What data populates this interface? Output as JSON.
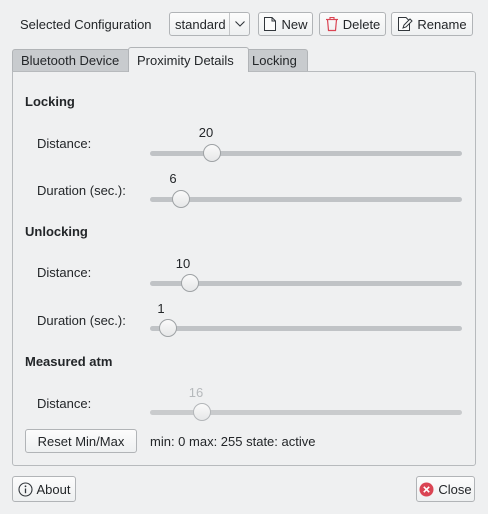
{
  "config": {
    "label": "Selected Configuration",
    "selected": "standard",
    "new_label": "New",
    "delete_label": "Delete",
    "rename_label": "Rename"
  },
  "tabs": [
    {
      "label": "Bluetooth Device"
    },
    {
      "label": "Proximity Details"
    },
    {
      "label": "Locking"
    }
  ],
  "locking": {
    "title": "Locking",
    "distance_label": "Distance:",
    "distance_value": "20",
    "duration_label": "Duration (sec.):",
    "duration_value": "6"
  },
  "unlocking": {
    "title": "Unlocking",
    "distance_label": "Distance:",
    "distance_value": "10",
    "duration_label": "Duration (sec.):",
    "duration_value": "1"
  },
  "measured": {
    "title": "Measured atm",
    "distance_label": "Distance:",
    "distance_value": "16",
    "reset_label": "Reset Min/Max",
    "status": "min: 0 max: 255 state: active"
  },
  "sliders": {
    "locking_distance": 0.18,
    "locking_duration": 0.075,
    "unlocking_distance": 0.105,
    "unlocking_duration": 0.03,
    "measured_distance": 0.147
  },
  "footer": {
    "about_label": "About",
    "close_label": "Close"
  },
  "colors": {
    "background": "#eff0f1",
    "delete_icon": "#da4453",
    "close_icon": "#da4453"
  }
}
